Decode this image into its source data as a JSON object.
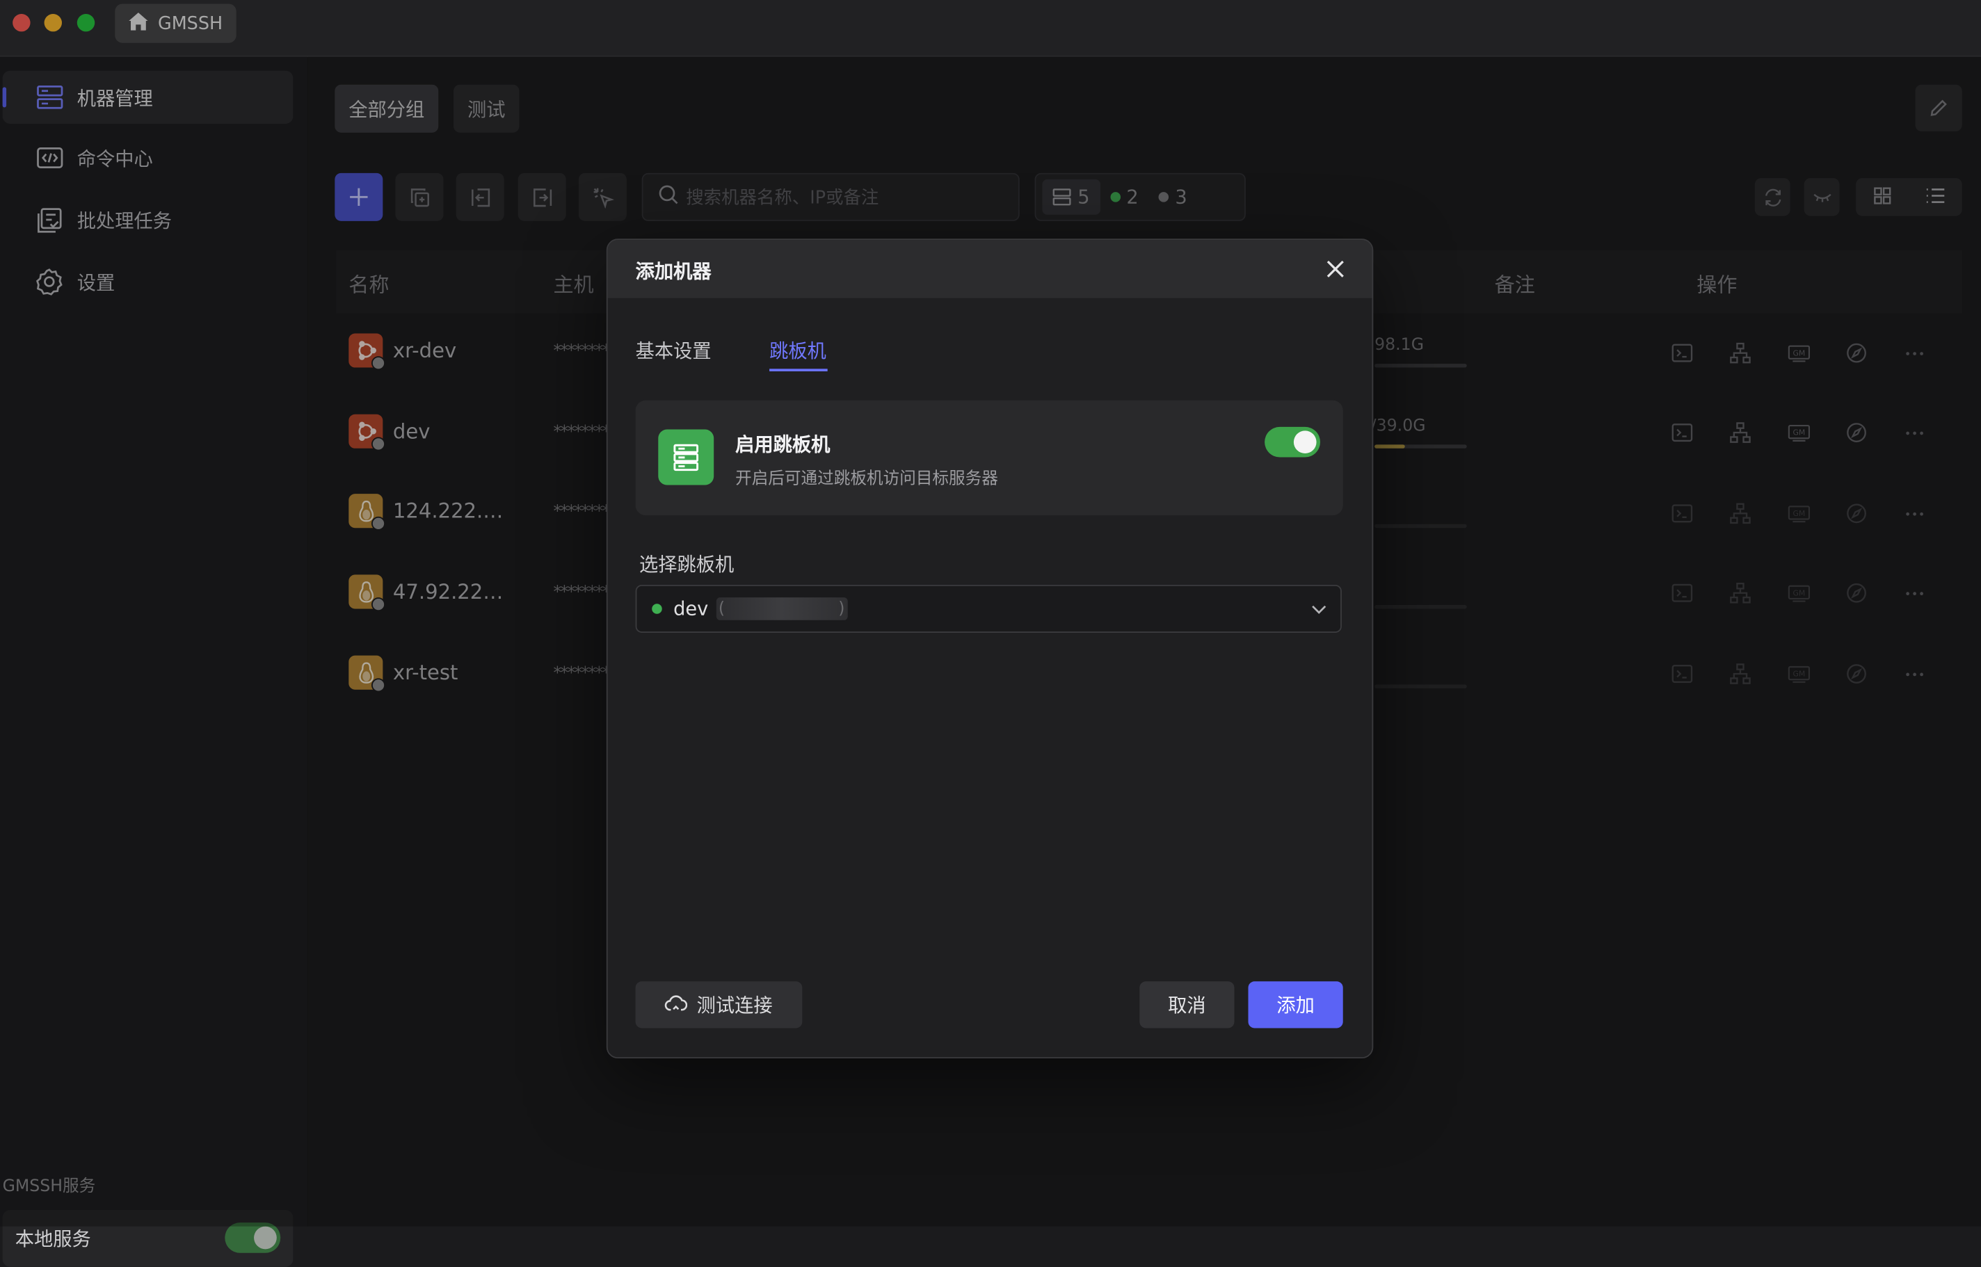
{
  "app": {
    "tab_title": "GMSSH"
  },
  "sidebar": {
    "items": [
      {
        "label": "机器管理",
        "icon": "server-icon"
      },
      {
        "label": "命令中心",
        "icon": "code-icon"
      },
      {
        "label": "批处理任务",
        "icon": "tasks-icon"
      },
      {
        "label": "设置",
        "icon": "gear-icon"
      }
    ],
    "service_section": "GMSSH服务",
    "local_service": {
      "label": "本地服务",
      "enabled": true
    }
  },
  "groups": [
    "全部分组",
    "测试"
  ],
  "search": {
    "placeholder": "搜索机器名称、IP或备注"
  },
  "stats": {
    "total": "5",
    "online": "2",
    "offline": "3"
  },
  "table": {
    "columns": [
      "名称",
      "主机",
      "备注",
      "操作"
    ],
    "rows": [
      {
        "name": "xr-dev",
        "os": "ubuntu",
        "host": "*********",
        "disk": "98.1G"
      },
      {
        "name": "dev",
        "os": "ubuntu",
        "host": "*********",
        "disk": "/39.0G"
      },
      {
        "name": "124.222.…",
        "os": "linux",
        "host": "*********",
        "disk": ""
      },
      {
        "name": "47.92.22…",
        "os": "linux",
        "host": "*********",
        "disk": ""
      },
      {
        "name": "xr-test",
        "os": "linux",
        "host": "*********",
        "disk": ""
      }
    ]
  },
  "modal": {
    "title": "添加机器",
    "tabs": [
      "基本设置",
      "跳板机"
    ],
    "active_tab": "跳板机",
    "jump": {
      "title": "启用跳板机",
      "subtitle": "开启后可通过跳板机访问目标服务器",
      "enabled": true
    },
    "select_label": "选择跳板机",
    "selected": {
      "name": "dev",
      "paren_open": "(",
      "paren_close": ")"
    },
    "buttons": {
      "test": "测试连接",
      "cancel": "取消",
      "add": "添加"
    }
  },
  "colors": {
    "accent": "#5b63f5",
    "success": "#3fa851",
    "ubuntu": "#b4472c",
    "linux": "#b38636"
  }
}
